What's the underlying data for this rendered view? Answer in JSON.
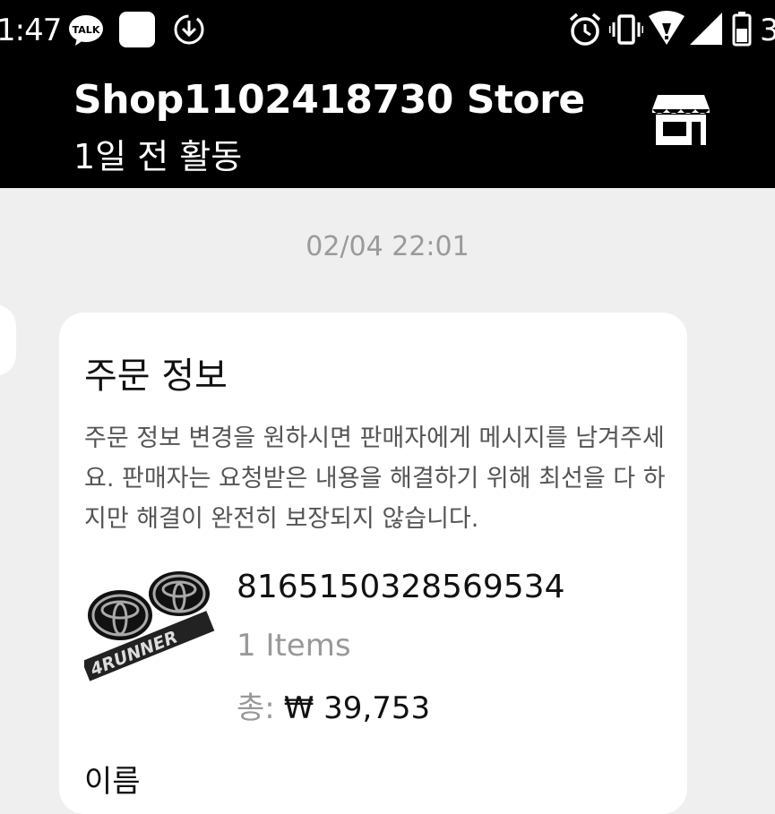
{
  "status_bar": {
    "time": "1:47",
    "talk_badge": "TALK",
    "battery_text": "3",
    "icons": [
      "kakaotalk-icon",
      "notification-square-icon",
      "download-icon",
      "alarm-icon",
      "vibrate-icon",
      "wifi-icon",
      "signal-icon",
      "battery-icon"
    ]
  },
  "header": {
    "title": "Shop1102418730 Store",
    "subtitle": "1일 전 활동",
    "store_icon": "store-icon"
  },
  "chat": {
    "timestamp": "02/04 22:01",
    "order_card": {
      "title": "주문 정보",
      "notice": "주문 정보 변경을 원하시면 판매자에게 메시지를 남겨주세요. 판매자는 요청받은 내용을 해결하기 위해 최선을 다 하지만 해결이 완전히 보장되지 않습니다.",
      "order_number": "8165150328569534",
      "items_count": "1 Items",
      "total_label": "총:",
      "total_value": "₩ 39,753",
      "product_image_text": "4RUNNER",
      "next_label": "이름"
    }
  },
  "colors": {
    "header_bg": "#000000",
    "page_bg": "#efefef",
    "card_bg": "#ffffff",
    "muted_text": "#999999"
  }
}
